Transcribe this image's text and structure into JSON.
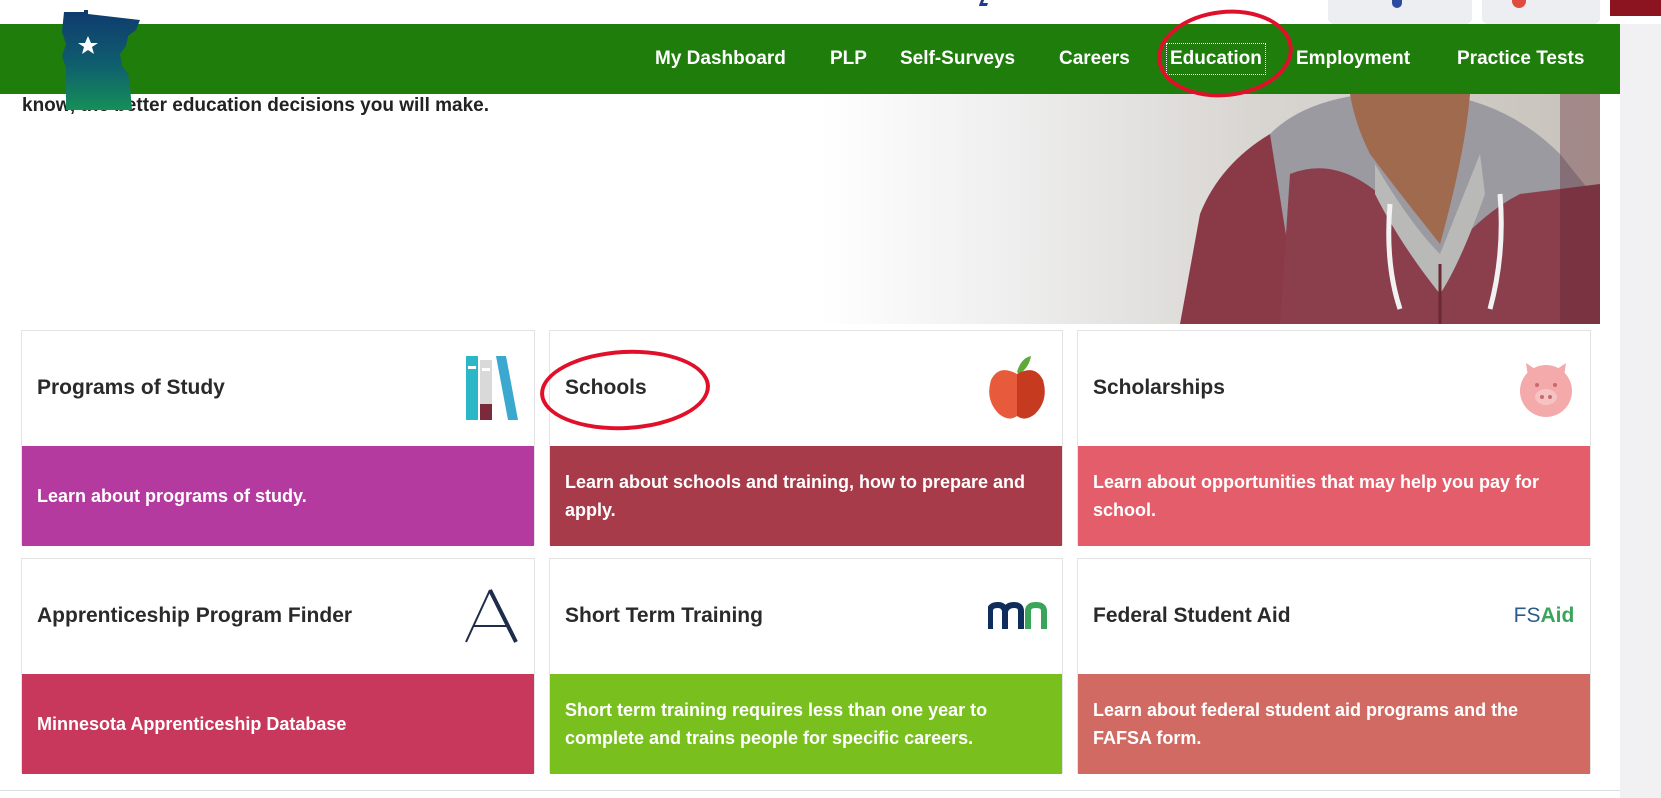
{
  "nav": {
    "items": [
      {
        "label": "My Dashboard"
      },
      {
        "label": "PLP"
      },
      {
        "label": "Self-Surveys"
      },
      {
        "label": "Careers"
      },
      {
        "label": "Education"
      },
      {
        "label": "Employment"
      },
      {
        "label": "Practice Tests"
      }
    ],
    "active": "Education"
  },
  "hero": {
    "text": "know, the better education decisions you will make."
  },
  "cards": [
    {
      "title": "Programs of Study",
      "description": "Learn about programs of study.",
      "icon": "books-icon",
      "color": "#b53aa0"
    },
    {
      "title": "Schools",
      "description": "Learn about schools and training, how to prepare and apply.",
      "icon": "apple-icon",
      "color": "#a83b4a"
    },
    {
      "title": "Scholarships",
      "description": "Learn about opportunities that may help you pay for school.",
      "icon": "piggy-bank-icon",
      "color": "#e45d6b"
    },
    {
      "title": "Apprenticeship Program Finder",
      "description": "Minnesota Apprenticeship Database",
      "icon": "apprenticeship-a-icon",
      "color": "#c8375c"
    },
    {
      "title": "Short Term Training",
      "description": "Short term training requires less than one year to complete and trains people for specific careers.",
      "icon": "mn-logo-icon",
      "color": "#79c01e"
    },
    {
      "title": "Federal Student Aid",
      "description": "Learn about federal student aid programs and the FAFSA form.",
      "icon": "fsaid-logo-icon",
      "color": "#d16a62",
      "icon_text_a": "FS",
      "icon_text_b": "Aid"
    }
  ],
  "colors": {
    "nav_green": "#1f7d0c",
    "highlight_red": "#e0102a"
  }
}
